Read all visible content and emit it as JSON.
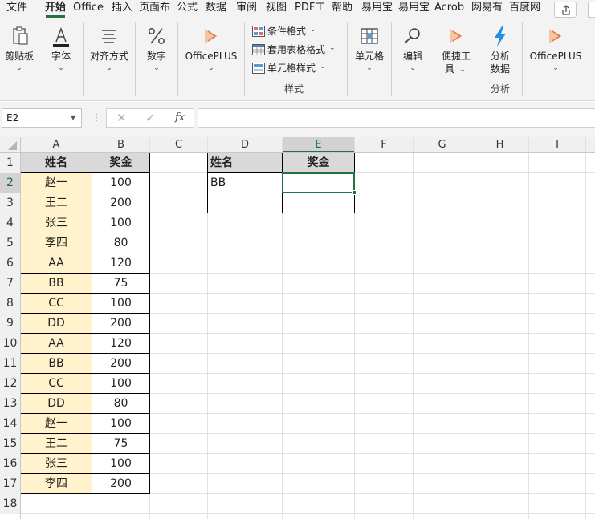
{
  "tabs": [
    {
      "label": "文件",
      "active": false
    },
    {
      "label": "开始",
      "active": true
    },
    {
      "label": "Office",
      "active": false
    },
    {
      "label": "插入",
      "active": false
    },
    {
      "label": "页面布",
      "active": false
    },
    {
      "label": "公式",
      "active": false
    },
    {
      "label": "数据",
      "active": false
    },
    {
      "label": "审阅",
      "active": false
    },
    {
      "label": "视图",
      "active": false
    },
    {
      "label": "PDF工",
      "active": false
    },
    {
      "label": "帮助",
      "active": false
    },
    {
      "label": "易用宝",
      "active": false
    },
    {
      "label": "易用宝",
      "active": false
    },
    {
      "label": "Acrob",
      "active": false
    },
    {
      "label": "网易有",
      "active": false
    },
    {
      "label": "百度网",
      "active": false
    }
  ],
  "ribbon": {
    "clipboard": "剪贴板",
    "font": "字体",
    "alignment": "对齐方式",
    "number": "数字",
    "officeplus1": "OfficePLUS",
    "conditional_format": "条件格式",
    "format_as_table": "套用表格格式",
    "cell_styles": "单元格样式",
    "styles_group": "样式",
    "cells": "单元格",
    "editing": "编辑",
    "quick_tools_line1": "便捷工",
    "quick_tools_line2": "具",
    "analyze_line1": "分析",
    "analyze_line2": "数据",
    "analysis_group": "分析",
    "officeplus2": "OfficePLUS"
  },
  "formula_bar": {
    "name_box": "E2",
    "formula": ""
  },
  "columns": [
    "A",
    "B",
    "C",
    "D",
    "E",
    "F",
    "G",
    "H",
    "I"
  ],
  "selected_column": "E",
  "rows": [
    "1",
    "2",
    "3",
    "4",
    "5",
    "6",
    "7",
    "8",
    "9",
    "10",
    "11",
    "12",
    "13",
    "14",
    "15",
    "16",
    "17",
    "18"
  ],
  "selected_row": "2",
  "table_left": {
    "header": {
      "name": "姓名",
      "bonus": "奖金"
    },
    "rows": [
      {
        "name": "赵一",
        "bonus": "100"
      },
      {
        "name": "王二",
        "bonus": "200"
      },
      {
        "name": "张三",
        "bonus": "100"
      },
      {
        "name": "李四",
        "bonus": "80"
      },
      {
        "name": "AA",
        "bonus": "120"
      },
      {
        "name": "BB",
        "bonus": "75"
      },
      {
        "name": "CC",
        "bonus": "100"
      },
      {
        "name": "DD",
        "bonus": "200"
      },
      {
        "name": "AA",
        "bonus": "120"
      },
      {
        "name": "BB",
        "bonus": "200"
      },
      {
        "name": "CC",
        "bonus": "100"
      },
      {
        "name": "DD",
        "bonus": "80"
      },
      {
        "name": "赵一",
        "bonus": "100"
      },
      {
        "name": "王二",
        "bonus": "75"
      },
      {
        "name": "张三",
        "bonus": "100"
      },
      {
        "name": "李四",
        "bonus": "200"
      }
    ]
  },
  "table_right": {
    "header": {
      "name": "姓名",
      "bonus": "奖金"
    },
    "rows": [
      {
        "name": "BB",
        "bonus": ""
      },
      {
        "name": "",
        "bonus": ""
      }
    ]
  },
  "colors": {
    "accent": "#217346",
    "name_fill": "#fff2cc",
    "header_fill": "#d9d9d9"
  }
}
